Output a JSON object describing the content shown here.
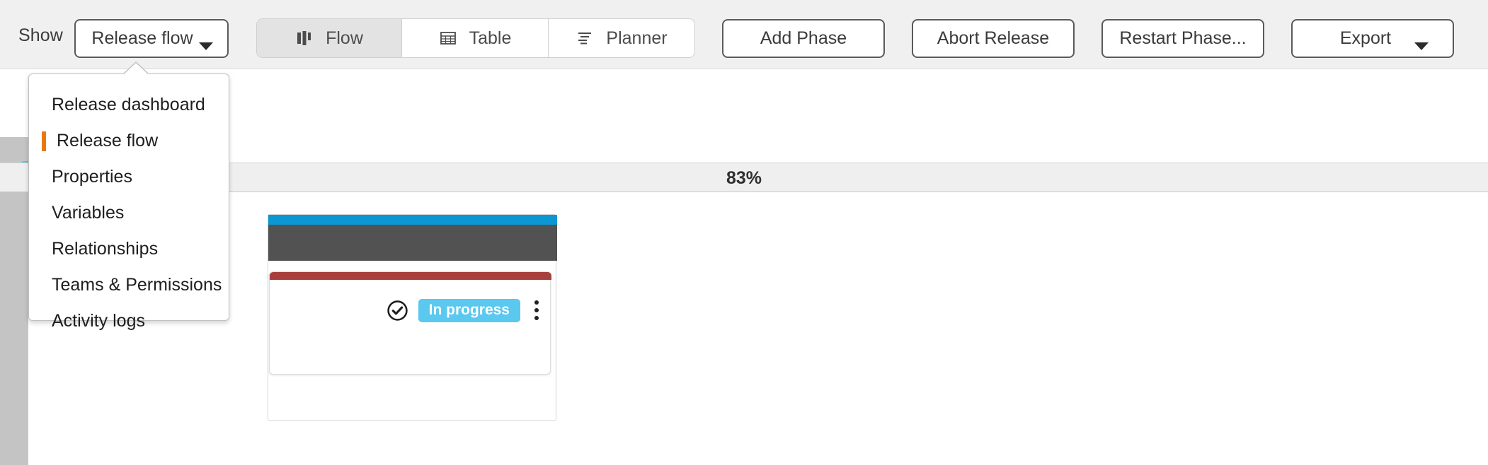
{
  "toolbar": {
    "show_label": "Show",
    "show_select_value": "Release flow",
    "view_tabs": [
      {
        "label": "Flow",
        "icon": "flow-bars-icon",
        "active": true
      },
      {
        "label": "Table",
        "icon": "table-grid-icon",
        "active": false
      },
      {
        "label": "Planner",
        "icon": "planner-lines-icon",
        "active": false
      }
    ],
    "actions": [
      {
        "label": "Add Phase",
        "name": "add-phase-button"
      },
      {
        "label": "Abort Release",
        "name": "abort-release-button"
      },
      {
        "label": "Restart Phase...",
        "name": "restart-phase-button"
      },
      {
        "label": "Export",
        "name": "export-button",
        "has_caret": true
      }
    ]
  },
  "menu": {
    "items": [
      {
        "label": "Release dashboard",
        "selected": false
      },
      {
        "label": "Release flow",
        "selected": true
      },
      {
        "label": "Properties",
        "selected": false
      },
      {
        "label": "Variables",
        "selected": false
      },
      {
        "label": "Relationships",
        "selected": false
      },
      {
        "label": "Teams & Permissions",
        "selected": false
      },
      {
        "label": "Activity logs",
        "selected": false
      }
    ]
  },
  "release": {
    "progress_percent": "83%",
    "task": {
      "status_label": "In progress",
      "status_color": "#5bc8ef",
      "accent_color": "#a83f3c"
    },
    "phase_bar_color": "#0b96d4",
    "phase_header_color": "#525252"
  }
}
